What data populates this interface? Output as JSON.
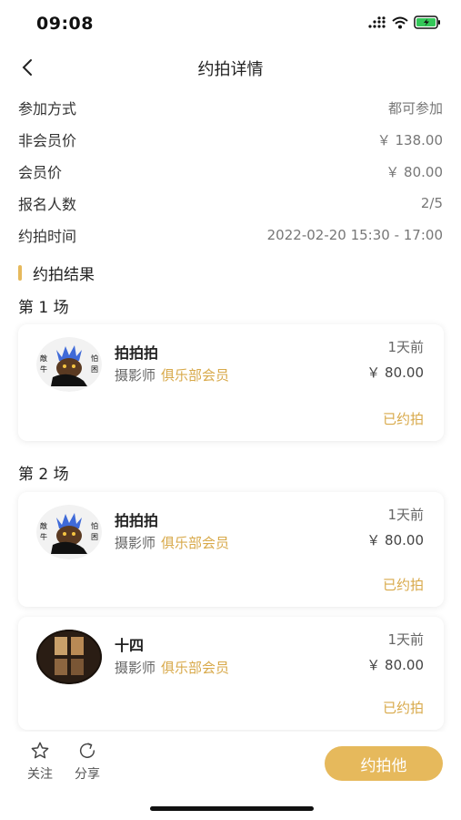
{
  "status_bar": {
    "time": "09:08"
  },
  "nav": {
    "title": "约拍详情"
  },
  "info": [
    {
      "label": "参加方式",
      "value": "都可参加"
    },
    {
      "label": "非会员价",
      "value": "￥ 138.00"
    },
    {
      "label": "会员价",
      "value": "￥ 80.00"
    },
    {
      "label": "报名人数",
      "value": "2/5"
    },
    {
      "label": "约拍时间",
      "value": "2022-02-20 15:30 - 17:00"
    }
  ],
  "section": {
    "title": "约拍结果"
  },
  "sessions": [
    {
      "title": "第 1 场"
    },
    {
      "title": "第 2 场"
    }
  ],
  "cards": [
    {
      "name": "拍拍拍",
      "role": "摄影师",
      "member": "俱乐部会员",
      "time": "1天前",
      "price": "￥ 80.00",
      "status": "已约拍",
      "avatar": "lion-avatar"
    },
    {
      "name": "拍拍拍",
      "role": "摄影师",
      "member": "俱乐部会员",
      "time": "1天前",
      "price": "￥ 80.00",
      "status": "已约拍",
      "avatar": "lion-avatar"
    },
    {
      "name": "十四",
      "role": "摄影师",
      "member": "俱乐部会员",
      "time": "1天前",
      "price": "￥ 80.00",
      "status": "已约拍",
      "avatar": "window-avatar"
    }
  ],
  "bottom": {
    "follow_label": "关注",
    "share_label": "分享",
    "book_label": "约拍他"
  },
  "colors": {
    "accent": "#e6b95c",
    "accent_text": "#d8a94a"
  }
}
